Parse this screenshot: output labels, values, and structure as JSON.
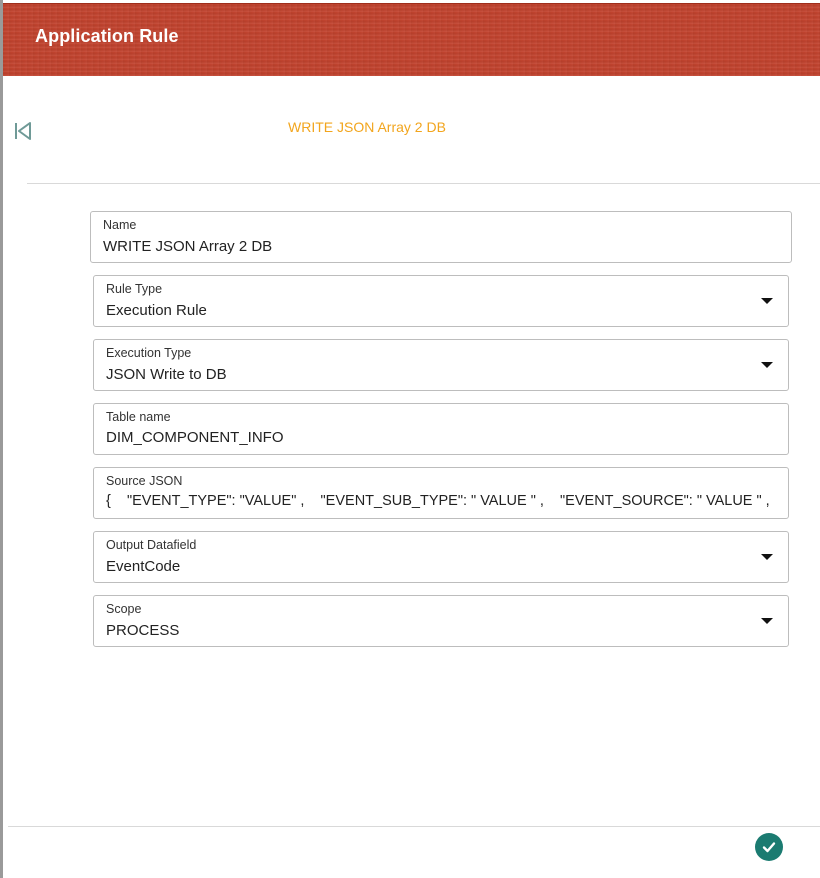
{
  "header": {
    "title": "Application Rule"
  },
  "page": {
    "subtitle": "WRITE JSON Array 2 DB"
  },
  "icons": {
    "back": "first-page-icon",
    "confirm": "check-circle-icon",
    "dropdown": "caret-down-icon"
  },
  "colors": {
    "header_bg": "#c1432e",
    "subtitle": "#f2a51d",
    "confirm_bg": "#1b7b71"
  },
  "form": {
    "name": {
      "label": "Name",
      "value": "WRITE JSON Array 2 DB"
    },
    "rule_type": {
      "label": "Rule Type",
      "value": "Execution Rule"
    },
    "execution_type": {
      "label": "Execution Type",
      "value": "JSON Write to DB"
    },
    "table_name": {
      "label": "Table name",
      "value": "DIM_COMPONENT_INFO"
    },
    "source_json": {
      "label": "Source JSON",
      "value": "{    \"EVENT_TYPE\": \"VALUE\" ,    \"EVENT_SUB_TYPE\": \" VALUE \" ,    \"EVENT_SOURCE\": \" VALUE \" ,"
    },
    "output_datafield": {
      "label": "Output Datafield",
      "value": "EventCode"
    },
    "scope": {
      "label": "Scope",
      "value": "PROCESS"
    }
  }
}
